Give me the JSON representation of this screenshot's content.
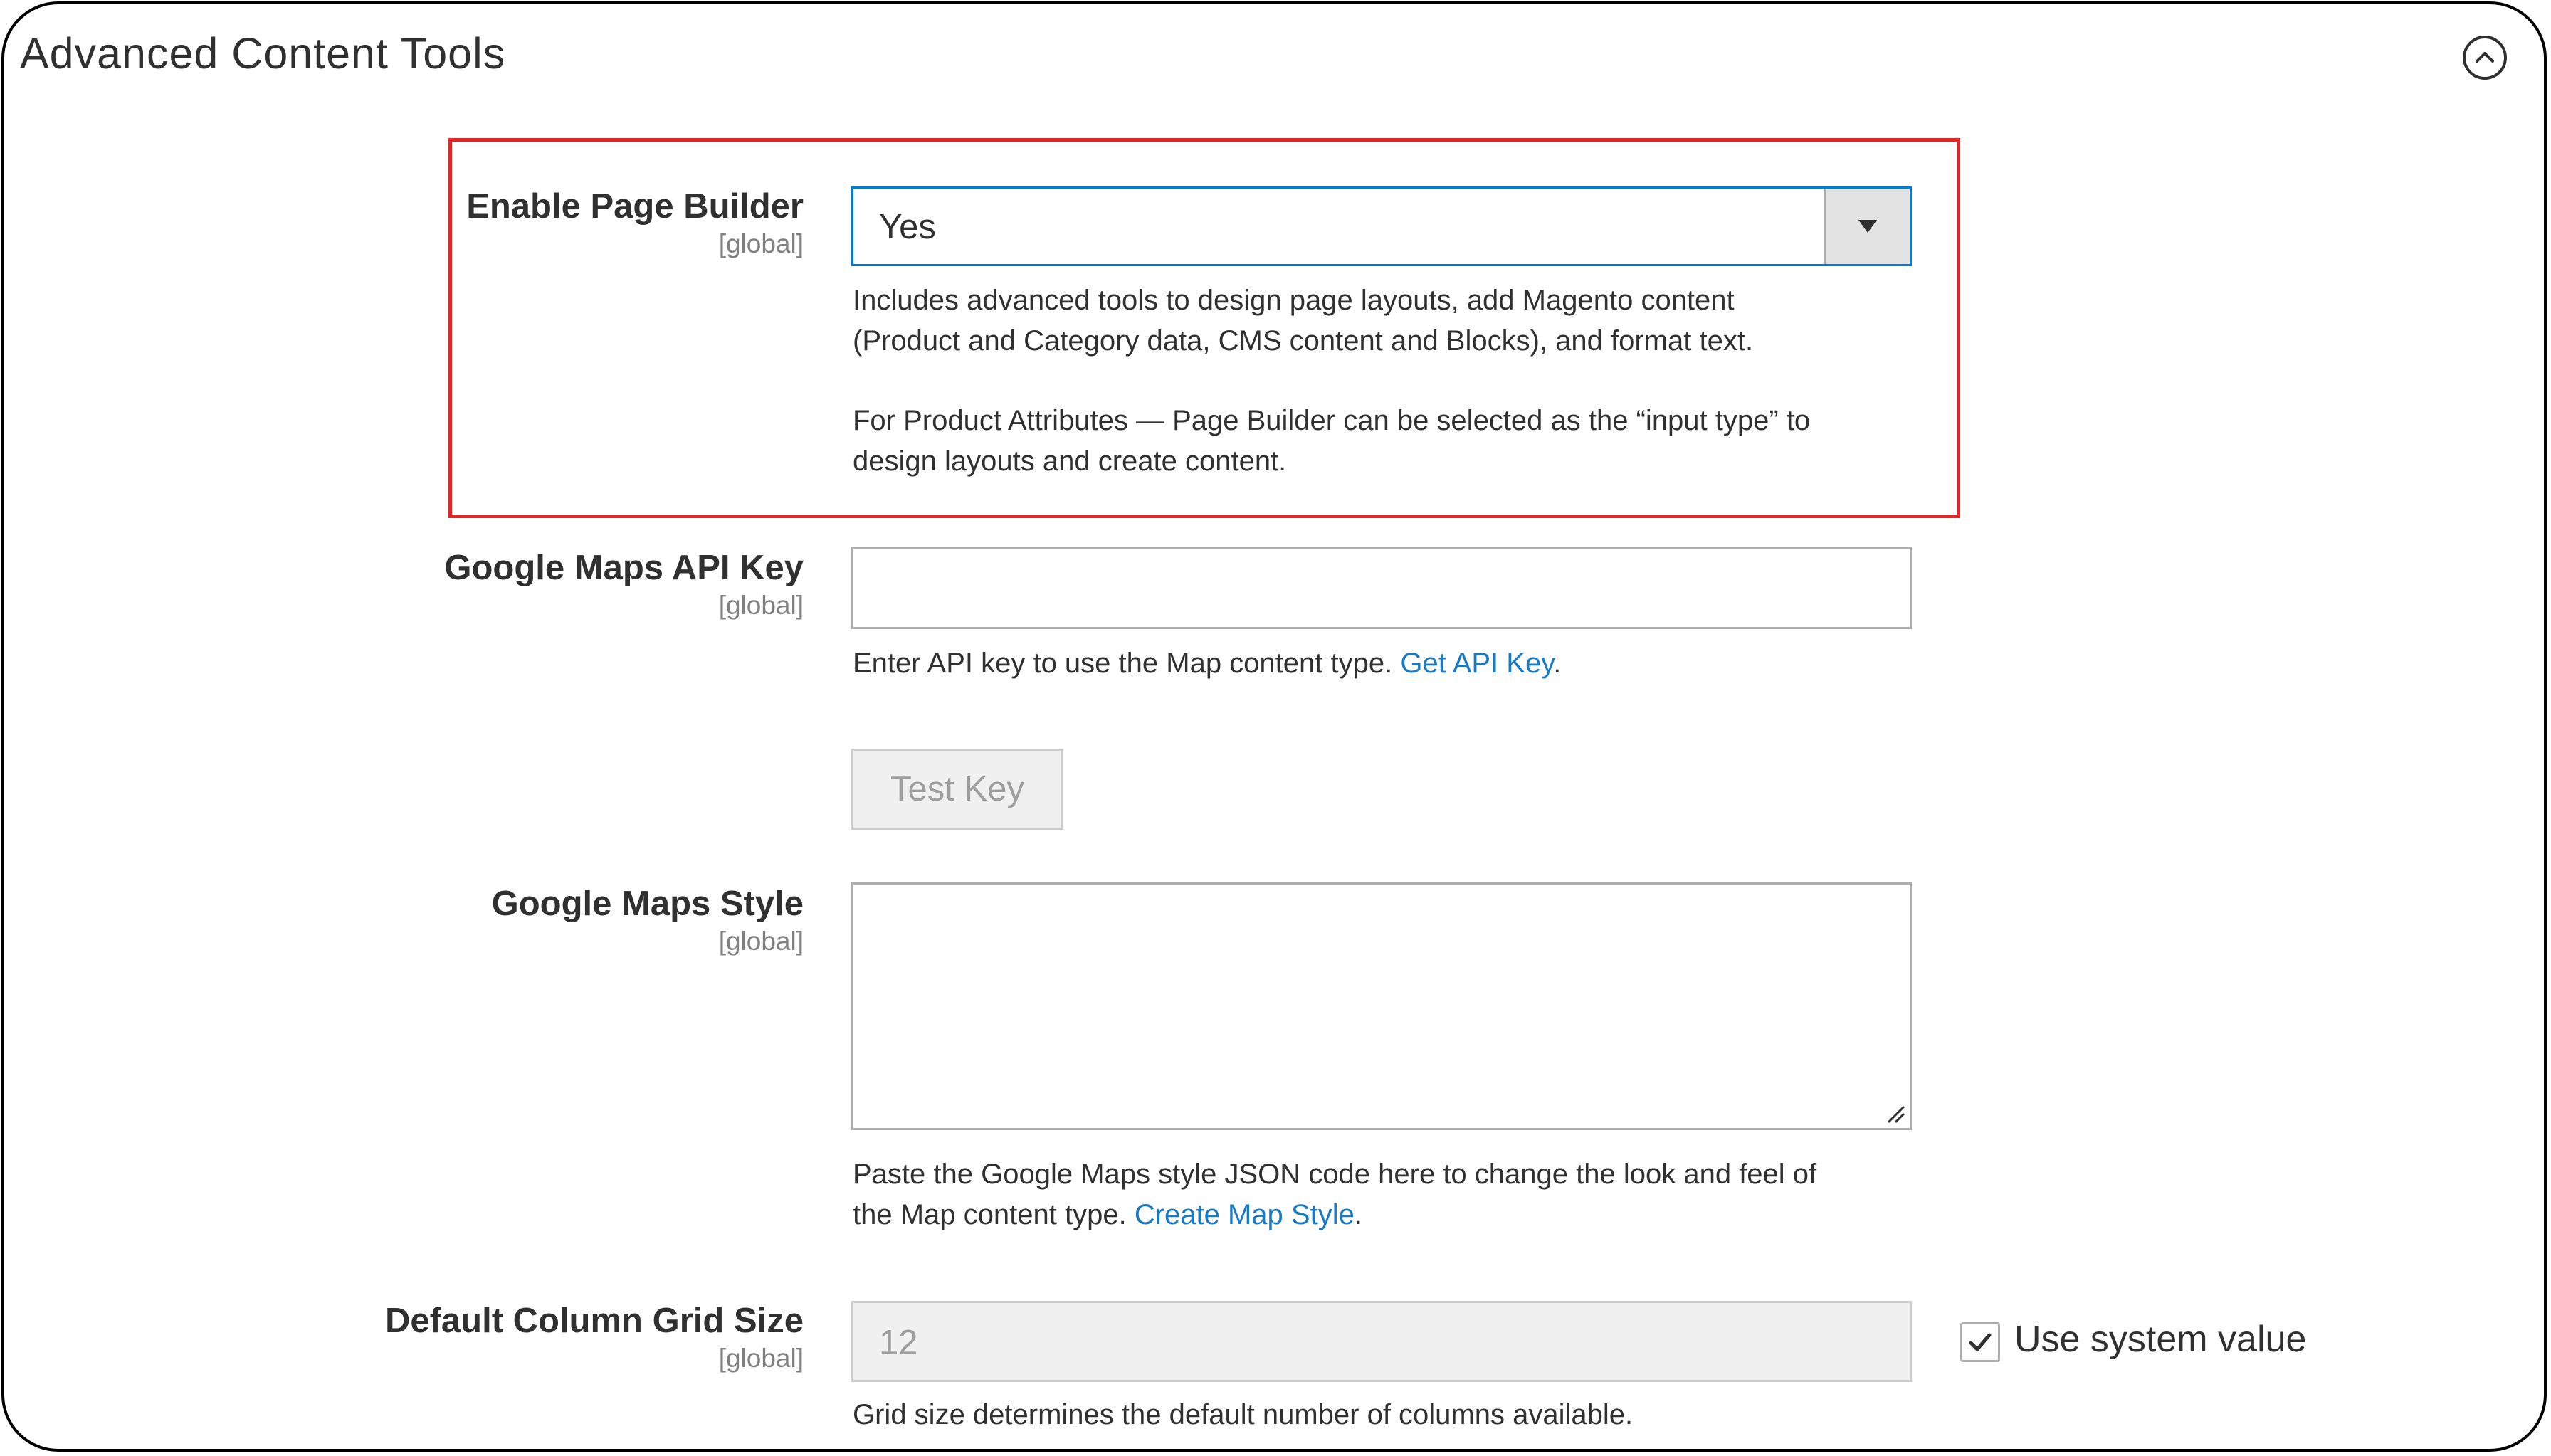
{
  "section": {
    "title": "Advanced Content Tools",
    "collapse_icon": "chevron-up-circle-icon"
  },
  "highlight_color": "#e22626",
  "link_color": "#1979c3",
  "fields": {
    "page_builder": {
      "label": "Enable Page Builder",
      "scope": "[global]",
      "selected_value": "Yes",
      "note_line1": "Includes advanced tools to design page layouts, add Magento content",
      "note_line2": "(Product and Category data, CMS content and Blocks), and format text.",
      "note_line3": "For Product Attributes — Page Builder can be selected as the “input type” to",
      "note_line4": "design layouts and create content."
    },
    "maps_api_key": {
      "label": "Google Maps API Key",
      "scope": "[global]",
      "value": "",
      "note_text": "Enter API key to use the Map content type. ",
      "note_link": "Get API Key",
      "note_suffix": ".",
      "test_button": "Test Key"
    },
    "maps_style": {
      "label": "Google Maps Style",
      "scope": "[global]",
      "value": "",
      "note_line1": "Paste the Google Maps style JSON code here to change the look and feel of",
      "note_text": "the Map content type. ",
      "note_link": "Create Map Style",
      "note_suffix": "."
    },
    "grid_size": {
      "label": "Default Column Grid Size",
      "scope": "[global]",
      "value": "12",
      "use_system_label": "Use system value",
      "use_system_checked": true,
      "note": "Grid size determines the default number of columns available."
    }
  }
}
